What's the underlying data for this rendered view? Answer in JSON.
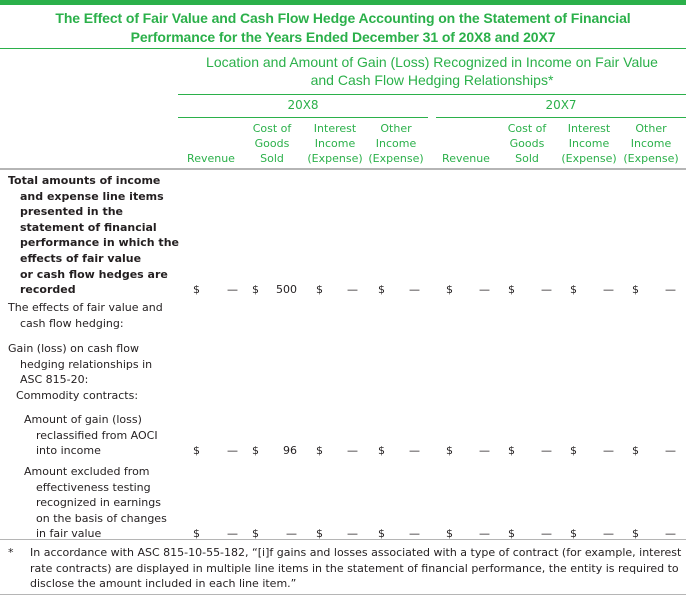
{
  "title": {
    "line1": "The Effect of Fair Value and Cash Flow Hedge Accounting on the Statement of Financial",
    "line2": "Performance for the Years Ended December 31 of 20X8 and 20X7"
  },
  "superheader": {
    "line1": "Location and Amount of Gain (Loss) Recognized in Income on Fair Value",
    "line2": "and Cash Flow Hedging Relationships*"
  },
  "years": [
    "20X8",
    "20X7"
  ],
  "columns": [
    {
      "lines": [
        "",
        "",
        "Revenue"
      ]
    },
    {
      "lines": [
        "Cost of",
        "Goods",
        "Sold"
      ]
    },
    {
      "lines": [
        "Interest",
        "Income",
        "(Expense)"
      ]
    },
    {
      "lines": [
        "Other",
        "Income",
        "(Expense)"
      ]
    },
    {
      "lines": [
        "",
        "",
        "Revenue"
      ]
    },
    {
      "lines": [
        "Cost of",
        "Goods",
        "Sold"
      ]
    },
    {
      "lines": [
        "Interest",
        "Income",
        "(Expense)"
      ]
    },
    {
      "lines": [
        "Other",
        "Income",
        "(Expense)"
      ]
    }
  ],
  "rows": [
    {
      "label": [
        "Total amounts of income",
        "and expense line items",
        "presented in the",
        "statement of financial",
        "performance in which the",
        "effects of fair value",
        "or cash flow hedges are",
        "recorded"
      ],
      "bold": true,
      "values": [
        "—",
        "500",
        "—",
        "—",
        "—",
        "—",
        "—",
        "—"
      ],
      "currency": "$"
    },
    {
      "label": [
        "The effects of fair value and",
        "cash flow hedging:"
      ],
      "bold": false,
      "values": []
    },
    {
      "label": [
        "Gain (loss) on cash flow",
        "hedging relationships in",
        "ASC 815-20:"
      ],
      "bold": false,
      "values": []
    },
    {
      "label": [
        "Commodity contracts:"
      ],
      "bold": false,
      "values": []
    },
    {
      "label": [
        "Amount of gain (loss)",
        "reclassified from AOCI",
        "into income"
      ],
      "bold": false,
      "values": [
        "—",
        "96",
        "—",
        "—",
        "—",
        "—",
        "—",
        "—"
      ],
      "currency": "$"
    },
    {
      "label": [
        "Amount excluded from",
        "effectiveness testing",
        "recognized in earnings",
        "on the basis of changes",
        "in fair value"
      ],
      "bold": false,
      "values": [
        "—",
        "—",
        "—",
        "—",
        "—",
        "—",
        "—",
        "—"
      ],
      "currency": "$"
    }
  ],
  "footnote": {
    "marker": "*",
    "text": "In accordance with ASC 815-10-55-182, “[i]f gains and losses associated with a type of contract (for example, interest rate contracts) are displayed in multiple line items in the statement of financial performance, the entity is required to disclose the amount included in each line item.”"
  },
  "colors": {
    "accent_green": "#2bb04a",
    "rule_gray": "#b5b5b5",
    "text": "#231f20"
  }
}
